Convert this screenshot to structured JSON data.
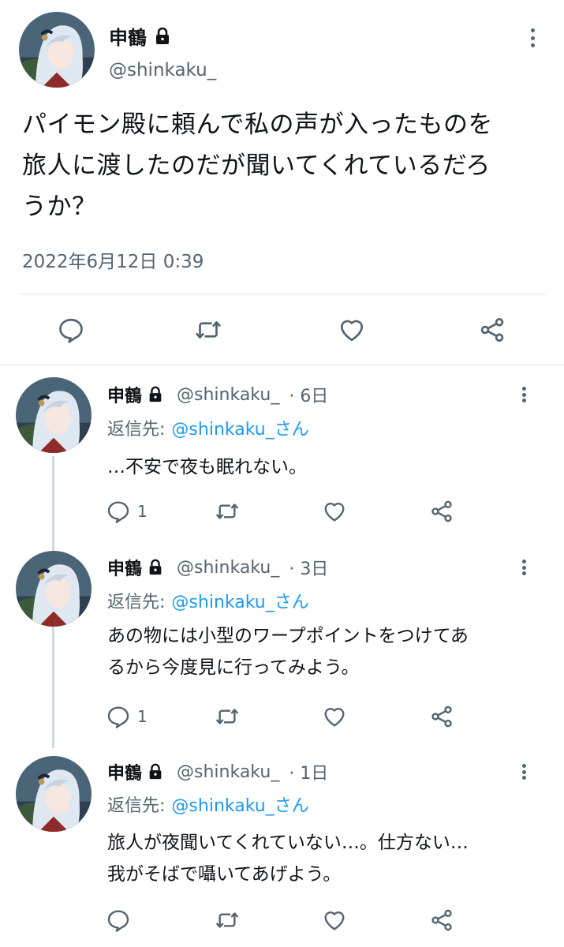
{
  "main_tweet": {
    "name": "申鶴",
    "handle": "@shinkaku_",
    "text_lines": [
      "パイモン殿に頼んで私の声が入ったものを",
      "旅人に渡したのだが聞いてくれているだろ",
      "うか？"
    ],
    "timestamp": "2022年6月12日 0:39"
  },
  "replies": [
    {
      "name": "申鶴",
      "handle": "@shinkaku_",
      "time": "· 6日",
      "reply_prefix": "返信先:",
      "reply_to": "@shinkaku_さん",
      "text_lines": [
        "…不安で夜も眠れない。"
      ],
      "reply_count": "1"
    },
    {
      "name": "申鶴",
      "handle": "@shinkaku_",
      "time": "· 3日",
      "reply_prefix": "返信先:",
      "reply_to": "@shinkaku_さん",
      "text_lines": [
        "あの物には小型のワープポイントをつけてあ",
        "るから今度見に行ってみよう。"
      ],
      "reply_count": "1"
    },
    {
      "name": "申鶴",
      "handle": "@shinkaku_",
      "time": "· 1日",
      "reply_prefix": "返信先:",
      "reply_to": "@shinkaku_さん",
      "text_lines": [
        "旅人が夜聞いてくれていない…。仕方ない…",
        "我がそばで囁いてあげよう。"
      ],
      "reply_count": ""
    }
  ],
  "icons": [
    "lock-icon",
    "more-icon",
    "reply-icon",
    "retweet-icon",
    "like-icon",
    "share-icon"
  ],
  "colors": {
    "text": "#0f1419",
    "secondary": "#536471",
    "link": "#1d9bf0",
    "divider": "#e2e6ea"
  }
}
